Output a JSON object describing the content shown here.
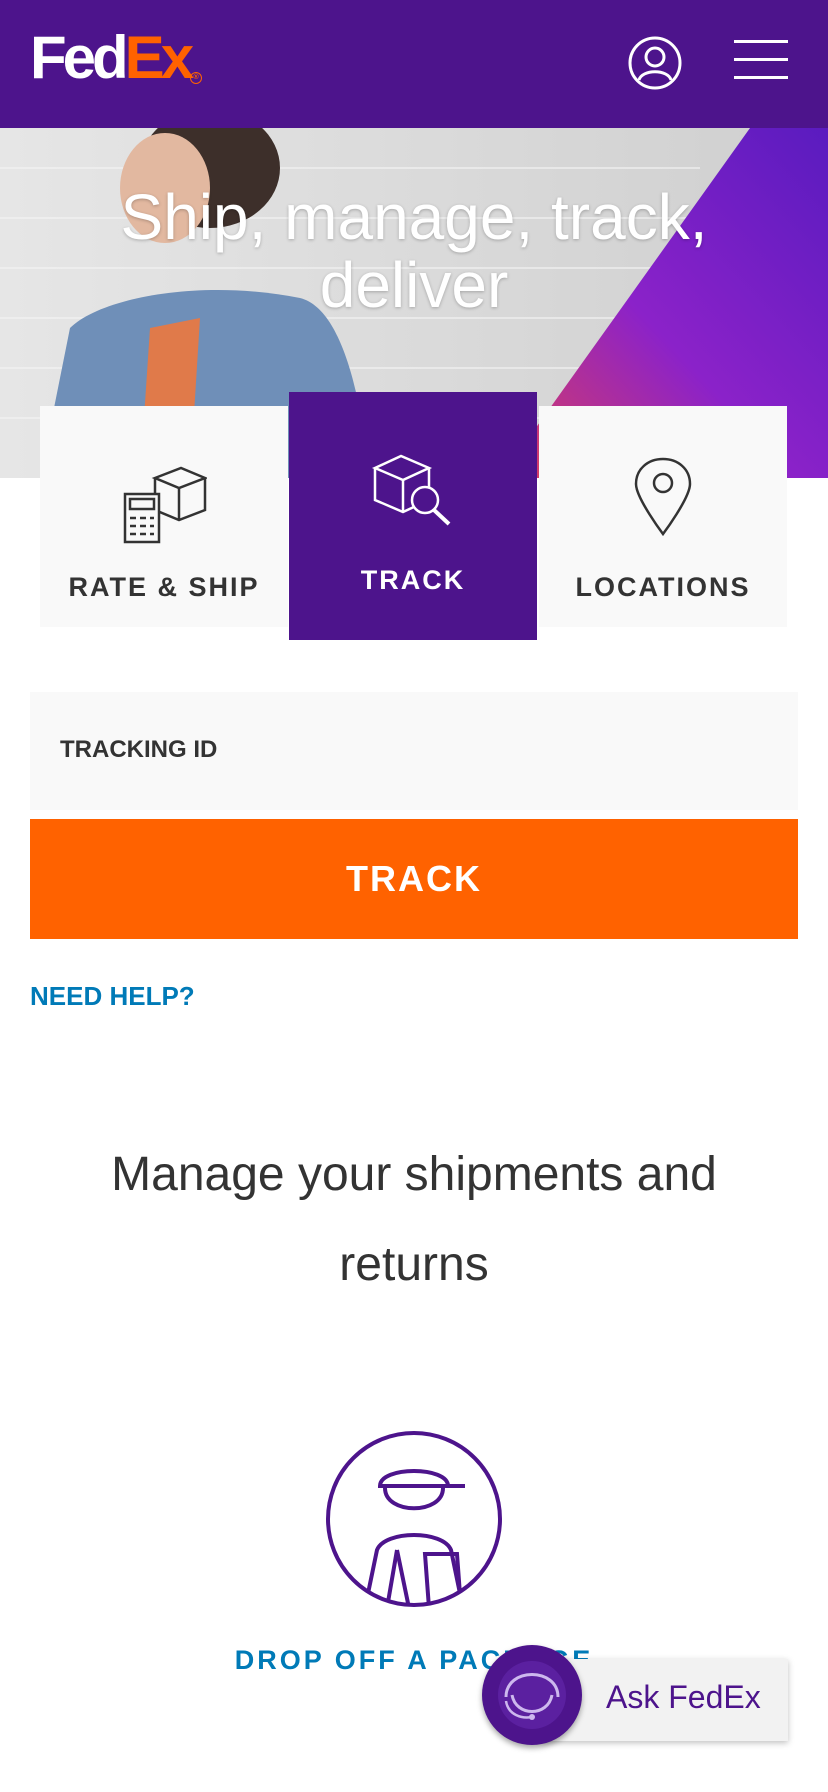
{
  "header": {
    "logo_fed": "Fed",
    "logo_ex": "Ex",
    "logo_reg": "®",
    "account_icon": "user-circle-icon",
    "menu_icon": "hamburger-menu-icon"
  },
  "hero": {
    "title_line1": "Ship, manage, track,",
    "title_line2": "deliver"
  },
  "tabs": [
    {
      "label": "RATE & SHIP",
      "icon": "calculator-box-icon",
      "active": false
    },
    {
      "label": "TRACK",
      "icon": "box-search-icon",
      "active": true
    },
    {
      "label": "LOCATIONS",
      "icon": "map-pin-icon",
      "active": false
    }
  ],
  "tracking": {
    "label": "TRACKING ID",
    "button": "TRACK",
    "help": "NEED HELP?"
  },
  "manage": {
    "title_line1": "Manage your shipments and",
    "title_line2": "returns",
    "drop_icon": "courier-icon",
    "drop_label": "DROP OFF A PACKAGE"
  },
  "ask": {
    "label": "Ask FedEx",
    "icon": "headset-agent-icon"
  },
  "colors": {
    "purple": "#4d148c",
    "orange": "#ff6200",
    "link": "#007ab7",
    "panel": "#f9f9f9"
  }
}
